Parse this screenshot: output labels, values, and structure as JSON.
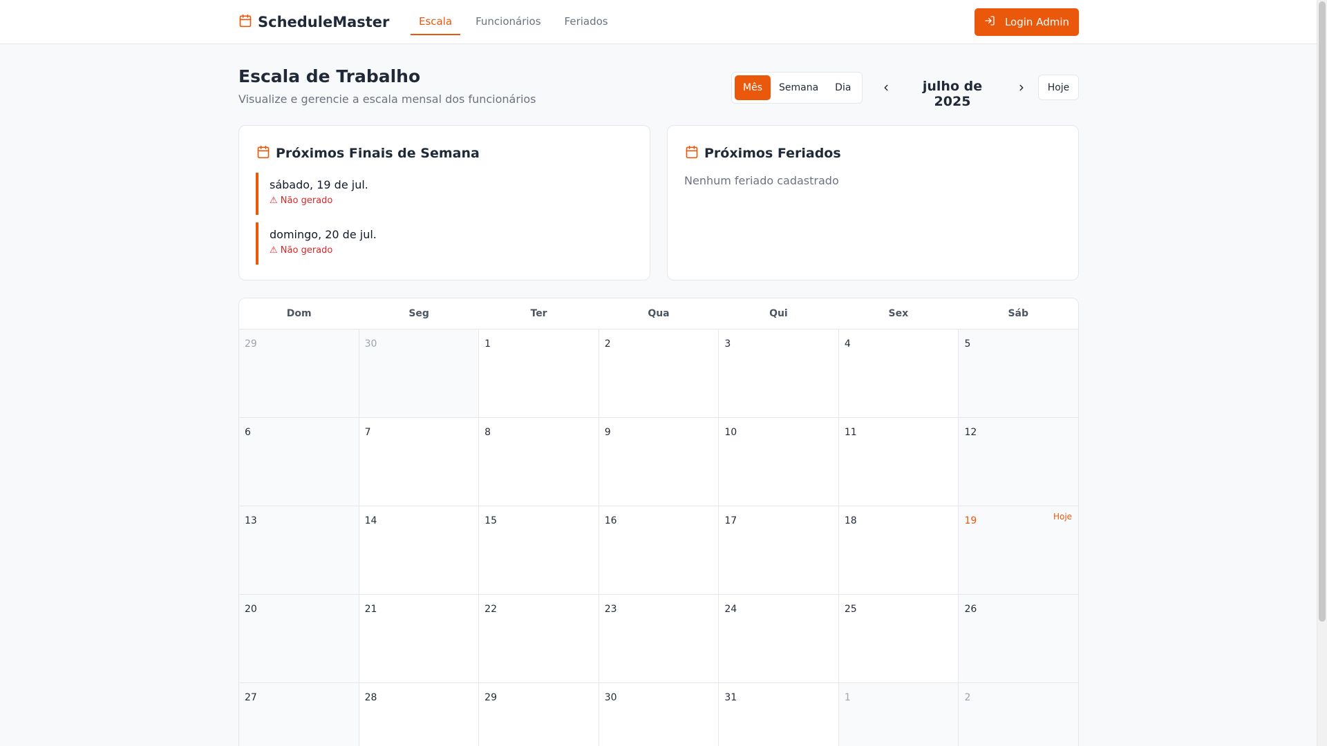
{
  "header": {
    "brand": "ScheduleMaster",
    "nav": [
      "Escala",
      "Funcionários",
      "Feriados"
    ],
    "login_label": "Login Admin"
  },
  "page": {
    "title": "Escala de Trabalho",
    "subtitle": "Visualize e gerencie a escala mensal dos funcionários"
  },
  "controls": {
    "views": [
      "Mês",
      "Semana",
      "Dia"
    ],
    "active_view": "Mês",
    "month": "julho de 2025",
    "today_label": "Hoje"
  },
  "weekends_card": {
    "title": "Próximos Finais de Semana",
    "items": [
      {
        "date": "sábado, 19 de jul.",
        "status": "⚠ Não gerado"
      },
      {
        "date": "domingo, 20 de jul.",
        "status": "⚠ Não gerado"
      }
    ]
  },
  "holidays_card": {
    "title": "Próximos Feriados",
    "empty": "Nenhum feriado cadastrado"
  },
  "calendar": {
    "weekdays": [
      "Dom",
      "Seg",
      "Ter",
      "Qua",
      "Qui",
      "Sex",
      "Sáb"
    ],
    "today_badge": "Hoje",
    "weeks": [
      [
        "29",
        "30",
        "1",
        "2",
        "3",
        "4",
        "5"
      ],
      [
        "6",
        "7",
        "8",
        "9",
        "10",
        "11",
        "12"
      ],
      [
        "13",
        "14",
        "15",
        "16",
        "17",
        "18",
        "19"
      ],
      [
        "20",
        "21",
        "22",
        "23",
        "24",
        "25",
        "26"
      ],
      [
        "27",
        "28",
        "29",
        "30",
        "31",
        "1",
        "2"
      ]
    ]
  },
  "colors": {
    "accent": "#ea580c",
    "warning": "#dc2626"
  }
}
